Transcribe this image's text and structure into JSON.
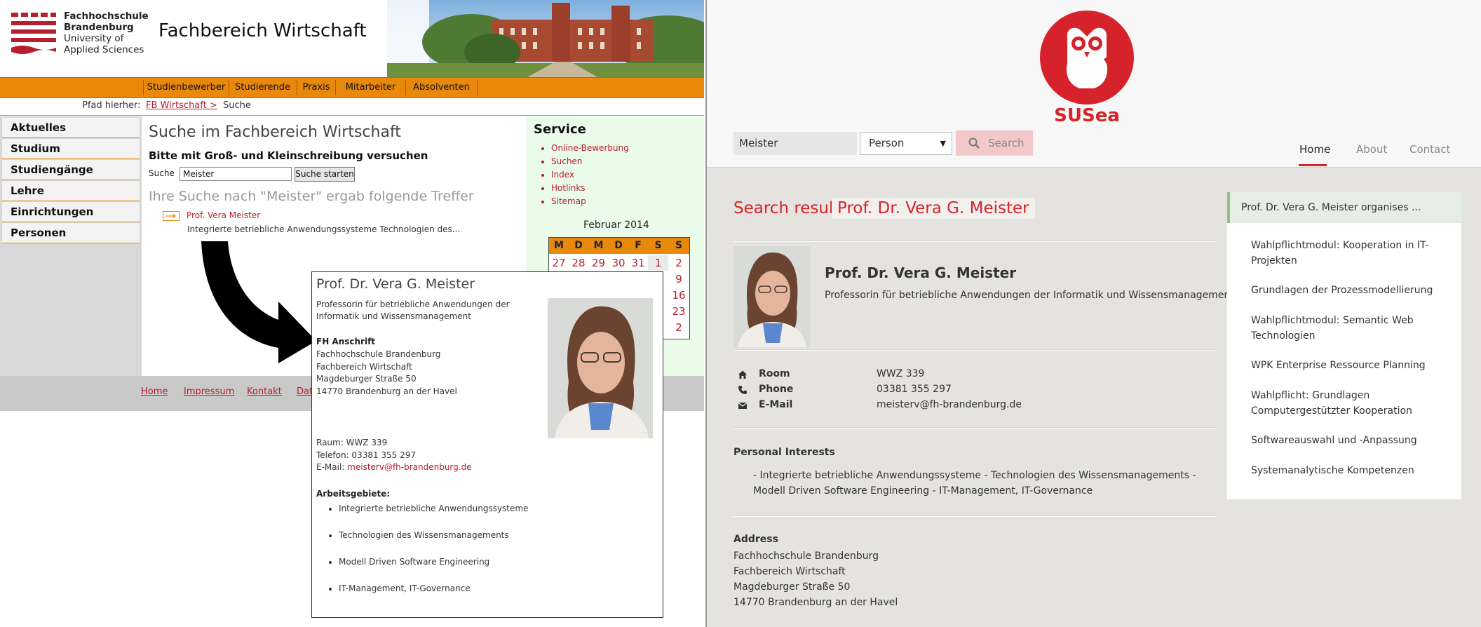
{
  "fh": {
    "logo": {
      "line1": "Fachhochschule",
      "line2": "Brandenburg",
      "line3": "University of",
      "line4": "Applied Sciences"
    },
    "header_title": "Fachbereich Wirtschaft",
    "nav": [
      "Studienbewerber",
      "Studierende",
      "Praxis",
      "Mitarbeiter",
      "Absolventen"
    ],
    "breadcrumb": {
      "label": "Pfad hierher:",
      "link": "FB Wirtschaft >",
      "current": "Suche"
    },
    "sidebar": [
      "Aktuelles",
      "Studium",
      "Studiengänge",
      "Lehre",
      "Einrichtungen",
      "Personen"
    ],
    "search": {
      "heading": "Suche im Fachbereich Wirtschaft",
      "hint": "Bitte mit Groß- und Kleinschreibung versuchen",
      "label": "Suche",
      "value": "Meister",
      "button": "Suche starten",
      "results_title": "Ihre Suche nach \"Meister\" ergab folgende Treffer",
      "result_link": "Prof. Vera Meister",
      "result_desc": "Integrierte betriebliche Anwendungssysteme Technologien des..."
    },
    "service": {
      "heading": "Service",
      "items": [
        "Online-Bewerbung",
        "Suchen",
        "Index",
        "Hotlinks",
        "Sitemap"
      ]
    },
    "calendar": {
      "title": "Februar 2014",
      "weekdays": [
        "M",
        "D",
        "M",
        "D",
        "F",
        "S",
        "S"
      ],
      "row1": [
        "27",
        "28",
        "29",
        "30",
        "31",
        "1",
        "2"
      ],
      "visible_days": [
        "9",
        "16",
        "23",
        "2"
      ]
    },
    "footer": [
      "Home",
      "Impressum",
      "Kontakt",
      "Dat"
    ],
    "card": {
      "title": "Prof. Dr. Vera G. Meister",
      "subtitle": "Professorin für betriebliche Anwendungen der Informatik und Wissensmanagement",
      "address_heading": "FH Anschrift",
      "address": [
        "Fachhochschule Brandenburg",
        "Fachbereich Wirtschaft",
        "Magdeburger Straße 50",
        "14770 Brandenburg an der Havel"
      ],
      "raum": "Raum: WWZ 339",
      "telefon": "Telefon: 03381 355 297",
      "email_label": "E-Mail: ",
      "email": "meisterv@fh-brandenburg.de",
      "areas_heading": "Arbeitsgebiete:",
      "areas": [
        "Integrierte betriebliche Anwendungssysteme",
        "Technologien des Wissensmanagements",
        "Modell Driven Software Engineering",
        "IT-Management, IT-Governance"
      ]
    }
  },
  "susea": {
    "brand": "SUSea",
    "search_value": "Meister",
    "select_value": "Person",
    "search_button": "Search",
    "nav": [
      "Home",
      "About",
      "Contact"
    ],
    "result_label": "Search result:",
    "result_name": "Prof. Dr. Vera G. Meister",
    "person": {
      "name": "Prof. Dr. Vera G. Meister",
      "position": "Professorin für betriebliche Anwendungen der Informatik und Wissensmanagement",
      "room_label": "Room",
      "room": "WWZ 339",
      "phone_label": "Phone",
      "phone": "03381 355 297",
      "email_label": "E-Mail",
      "email": "meisterv@fh-brandenburg.de"
    },
    "interests_heading": "Personal Interests",
    "interests_text": "- Integrierte betriebliche Anwendungssysteme - Technologien des Wissensmanagements - Modell Driven Software Engineering - IT-Management, IT-Governance",
    "address_heading": "Address",
    "address": [
      "Fachhochschule Brandenburg",
      "Fachbereich Wirtschaft",
      "Magdeburger Straße 50",
      "14770 Brandenburg an der Havel"
    ],
    "organises_heading": "Prof. Dr. Vera G. Meister organises ...",
    "organises": [
      "Wahlpflichtmodul: Kooperation in IT-Projekten",
      "Grundlagen der Prozessmodellierung",
      "Wahlpflichtmodul: Semantic Web Technologien",
      "WPK Enterprise Ressource Planning",
      "Wahlpflicht: Grundlagen Computergestützter Kooperation",
      "Softwareauswahl und -Anpassung",
      "Systemanalytische Kompetenzen"
    ]
  },
  "colors": {
    "fh_red": "#b51f2e",
    "fh_orange": "#e8890c",
    "susea_red": "#d6222a"
  }
}
